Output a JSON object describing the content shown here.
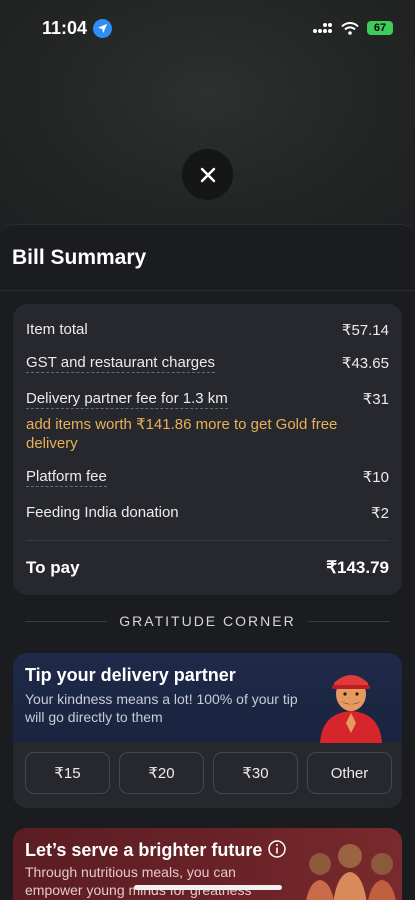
{
  "status_bar": {
    "time": "11:04",
    "battery": "67"
  },
  "sheet": {
    "title": "Bill Summary"
  },
  "bill": {
    "item_total": {
      "label": "Item total",
      "value": "₹57.14"
    },
    "gst": {
      "label": "GST and restaurant charges",
      "value": "₹43.65"
    },
    "delivery": {
      "label": "Delivery partner fee for 1.3 km",
      "value": "₹31"
    },
    "gold_note": "add items worth ₹141.86 more to get Gold free delivery",
    "platform_fee": {
      "label": "Platform fee",
      "value": "₹10"
    },
    "donation": {
      "label": "Feeding India donation",
      "value": "₹2"
    },
    "to_pay": {
      "label": "To pay",
      "value": "₹143.79"
    }
  },
  "gratitude": {
    "heading": "GRATITUDE CORNER"
  },
  "tip": {
    "title": "Tip your delivery partner",
    "subtitle": "Your kindness means a lot! 100% of your tip will go directly to them",
    "options": [
      "₹15",
      "₹20",
      "₹30",
      "Other"
    ]
  },
  "feeding": {
    "title": "Let’s serve a brighter future",
    "subtitle": "Through nutritious meals, you can empower young minds for greatness"
  },
  "colors": {
    "accent_gold": "#e8b057",
    "battery_green": "#3dcd5a",
    "location_blue": "#2f8ef5"
  }
}
